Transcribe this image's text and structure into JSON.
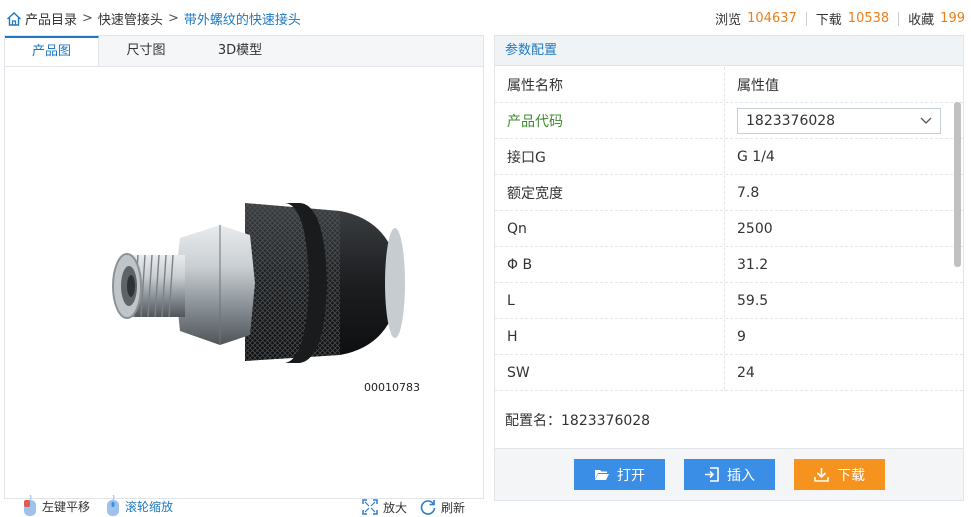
{
  "breadcrumb": {
    "items": [
      "产品目录",
      "快速管接头",
      "带外螺纹的快速接头"
    ],
    "separator": ">"
  },
  "stats": {
    "views_label": "浏览",
    "views": "104637",
    "downloads_label": "下载",
    "downloads": "10538",
    "favorites_label": "收藏",
    "favorites": "199"
  },
  "tabs": [
    "产品图",
    "尺寸图",
    "3D模型"
  ],
  "viewer": {
    "part_code": "00010783",
    "pan_label": "左键平移",
    "zoom_label": "滚轮缩放",
    "enlarge_label": "放大",
    "refresh_label": "刷新"
  },
  "params": {
    "title": "参数配置",
    "header": {
      "name": "属性名称",
      "value": "属性值"
    },
    "code_label": "产品代码",
    "code_value": "1823376028",
    "rows": [
      {
        "name": "接口G",
        "value": "G 1/4"
      },
      {
        "name": "额定宽度",
        "value": "7.8"
      },
      {
        "name": "Qn",
        "value": "2500"
      },
      {
        "name": "Φ B",
        "value": "31.2"
      },
      {
        "name": "L",
        "value": "59.5"
      },
      {
        "name": "H",
        "value": "9"
      },
      {
        "name": "SW",
        "value": "24"
      }
    ],
    "config_label": "配置名：",
    "config_value": "1823376028"
  },
  "actions": {
    "open": "打开",
    "insert": "插入",
    "download": "下载"
  },
  "colors": {
    "accent": "#1f78c1",
    "orange": "#ef7d1a",
    "button_blue": "#3a8ee6",
    "button_orange": "#f6931f",
    "green": "#3f8a2f"
  }
}
